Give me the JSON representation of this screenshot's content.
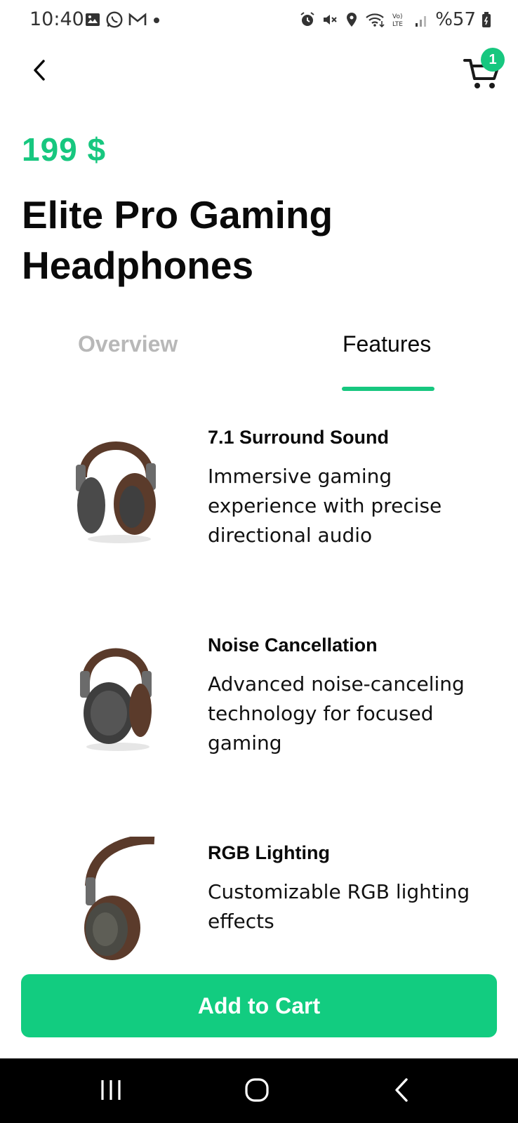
{
  "status_bar": {
    "time": "10:40",
    "battery_text": "%57",
    "left_icons": [
      "image-icon",
      "whatsapp-icon",
      "gmail-icon",
      "dot-icon"
    ],
    "right_icons": [
      "alarm-icon",
      "mute-icon",
      "location-icon",
      "wifi-icon",
      "volte-icon",
      "signal-icon",
      "battery-icon"
    ]
  },
  "header": {
    "back_icon": "chevron-left-icon",
    "cart_icon": "cart-icon",
    "cart_count": "1"
  },
  "product": {
    "price": "199 $",
    "title": "Elite Pro Gaming Headphones"
  },
  "tabs": [
    {
      "label": "Overview",
      "active": false
    },
    {
      "label": "Features",
      "active": true
    }
  ],
  "features": [
    {
      "title": "7.1 Surround Sound",
      "description": "Immersive gaming experience with precise directional audio",
      "image": "headphones-image"
    },
    {
      "title": "Noise Cancellation",
      "description": "Advanced noise-canceling technology for focused gaming",
      "image": "headphones-image"
    },
    {
      "title": "RGB Lighting",
      "description": "Customizable RGB lighting effects",
      "image": "headphones-image"
    }
  ],
  "add_to_cart_label": "Add to Cart",
  "colors": {
    "accent": "#17c77f",
    "button": "#12cc80",
    "inactive_tab": "#b8b8b8"
  },
  "nav_bar": {
    "buttons": [
      "recents-icon",
      "home-icon",
      "back-icon"
    ]
  }
}
